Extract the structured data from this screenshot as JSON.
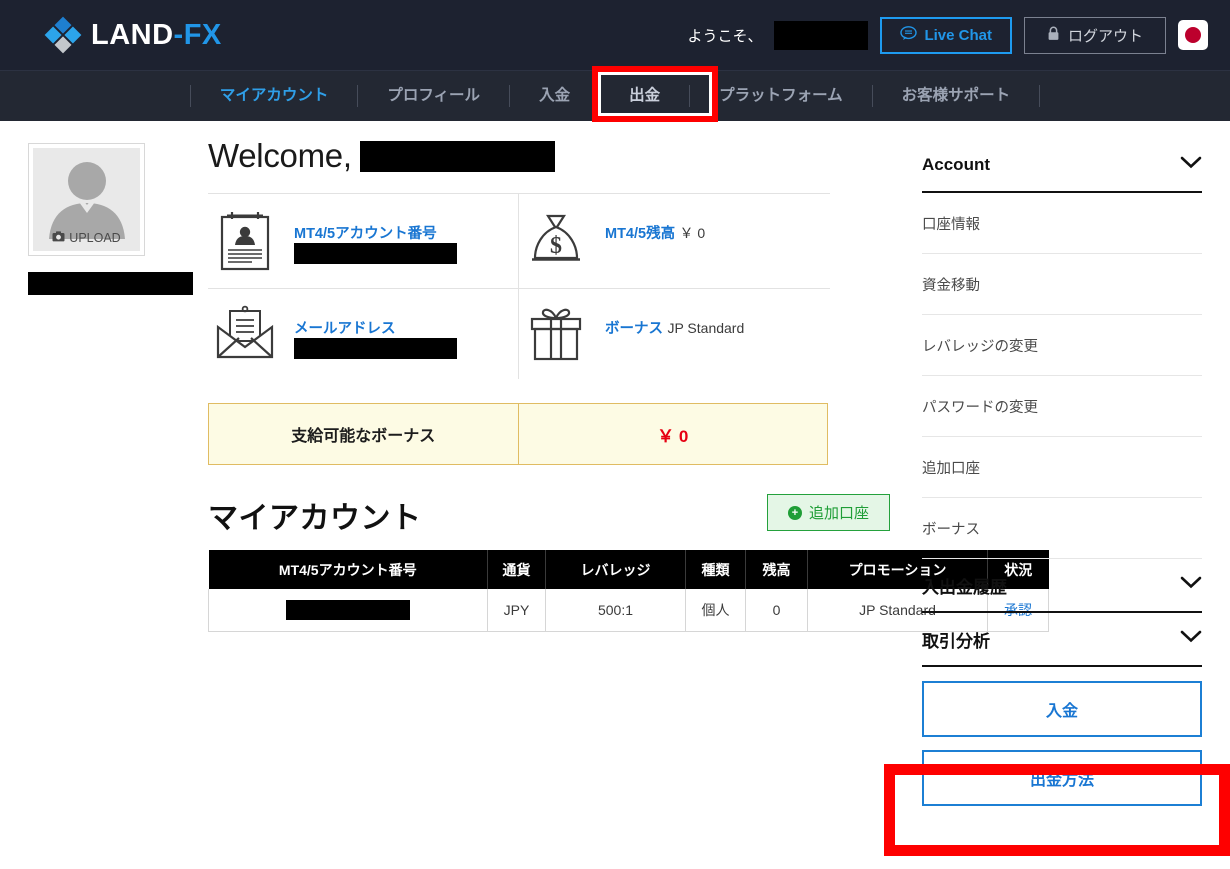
{
  "header": {
    "logo_text_land": "LAND",
    "logo_text_fx": "-FX",
    "logo_icon": "diamond-logo-icon",
    "welcome_label": "ようこそ、",
    "live_chat_label": "Live Chat",
    "live_chat_icon": "chat-bubble-icon",
    "logout_label": "ログアウト",
    "logout_icon": "lock-icon",
    "flag_icon": "japan-flag-icon",
    "accent_blue": "#2196e8",
    "bar_bg": "#1d2230"
  },
  "nav": {
    "items": [
      {
        "label": "マイアカウント",
        "state": "active"
      },
      {
        "label": "プロフィール",
        "state": "normal"
      },
      {
        "label": "入金",
        "state": "normal"
      },
      {
        "label": "出金",
        "state": "highlighted"
      },
      {
        "label": "プラットフォーム",
        "state": "normal"
      },
      {
        "label": "お客様サポート",
        "state": "normal"
      }
    ],
    "highlight_color": "#fe0000",
    "highlight_target": "出金"
  },
  "avatar": {
    "upload_label": "UPLOAD",
    "upload_icon": "camera-icon",
    "person_icon": "person-placeholder-icon",
    "name_redacted": true
  },
  "main": {
    "welcome_title": "Welcome,",
    "welcome_name_redacted": true,
    "info_cards": [
      {
        "icon": "id-card-icon",
        "label": "MT4/5アカウント番号",
        "value": "",
        "redacted": true
      },
      {
        "icon": "money-bag-icon",
        "label": "MT4/5残高",
        "value": "￥ 0",
        "redacted": false
      },
      {
        "icon": "envelope-icon",
        "label": "メールアドレス",
        "value": "",
        "redacted": true
      },
      {
        "icon": "gift-box-icon",
        "label": "ボーナス",
        "value": "JP Standard",
        "redacted": false
      }
    ],
    "bonus_banner": {
      "label": "支給可能なボーナス",
      "amount": "￥ 0",
      "amount_color": "#e60012",
      "bg": "#fdfbe4",
      "border": "#e0bc62"
    },
    "accounts_heading": "マイアカウント",
    "add_account_label": "追加口座",
    "add_account_icon": "plus-circle-icon",
    "table": {
      "columns": [
        "MT4/5アカウント番号",
        "通貨",
        "レバレッジ",
        "種類",
        "残高",
        "プロモーション",
        "状況"
      ],
      "rows": [
        {
          "account_number": "",
          "account_redacted": true,
          "currency": "JPY",
          "leverage": "500:1",
          "type": "個人",
          "balance": "0",
          "promotion": "JP Standard",
          "status": "承認"
        }
      ]
    }
  },
  "sidebar": {
    "groups": [
      {
        "title": "Account",
        "chevron_icon": "chevron-down-icon",
        "links": [
          "口座情報",
          "資金移動",
          "レバレッジの変更",
          "パスワードの変更",
          "追加口座",
          "ボーナス"
        ]
      },
      {
        "title": "入出金履歴",
        "chevron_icon": "chevron-down-icon",
        "links": []
      },
      {
        "title": "取引分析",
        "chevron_icon": "chevron-down-icon",
        "links": []
      }
    ],
    "buttons": [
      {
        "label": "入金",
        "highlighted": false
      },
      {
        "label": "出金方法",
        "highlighted": true
      }
    ],
    "button_border": "#1c7fd4",
    "button_text": "#1976d2",
    "highlight_color": "#fe0000"
  }
}
